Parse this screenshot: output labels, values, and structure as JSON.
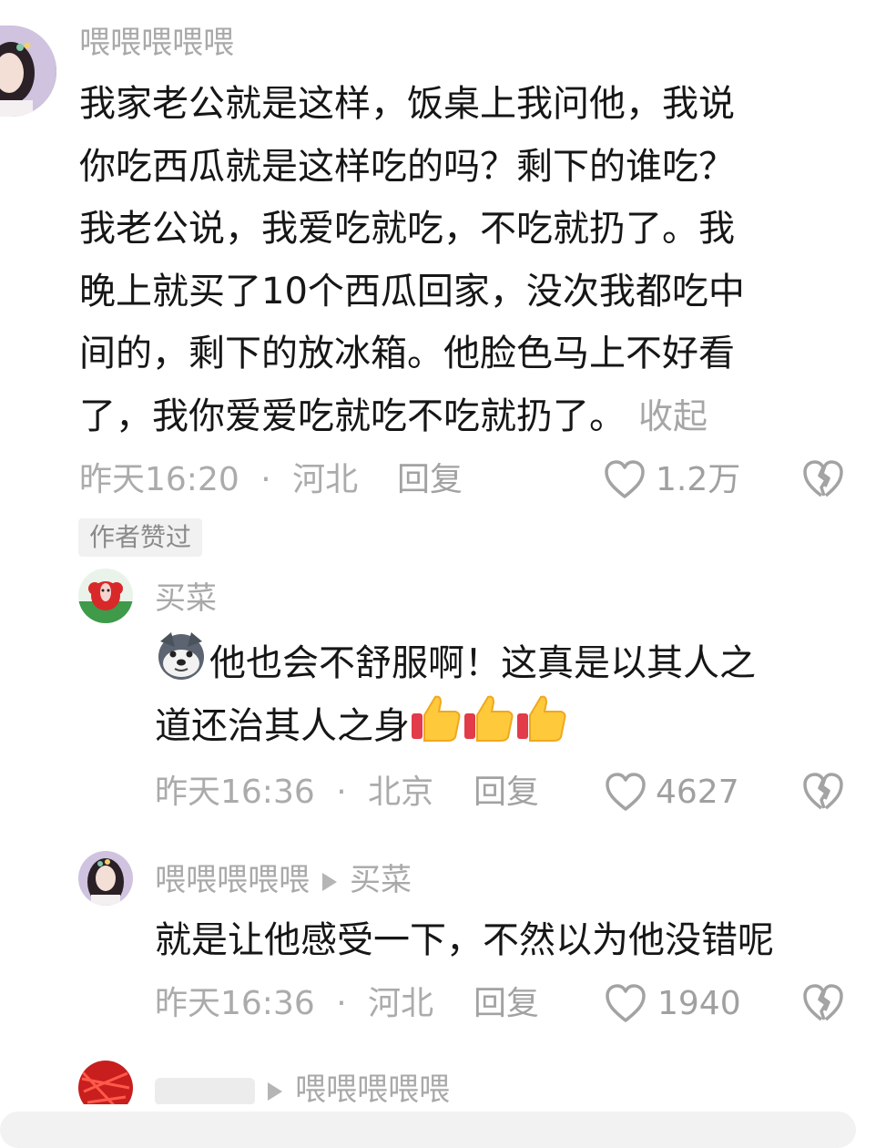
{
  "comments": [
    {
      "username": "喂喂喂喂喂",
      "text_lines": [
        "我家老公就是这样，饭桌上我问他，我说",
        "你吃西瓜就是这样吃的吗？剩下的谁吃？",
        "我老公说，我爱吃就吃，不吃就扔了。我",
        "晚上就买了10个西瓜回家，没次我都吃中",
        "间的，剩下的放冰箱。他脸色马上不好看",
        "了，我你爱爱吃就吃不吃就扔了。"
      ],
      "collapse_label": "收起",
      "time": "昨天16:20",
      "separator": "·",
      "location": "河北",
      "reply_label": "回复",
      "like_count": "1.2万",
      "author_badge": "作者赞过"
    },
    {
      "username": "买菜",
      "text_lines": [
        "他也会不舒服啊！这真是以其人之",
        "道还治其人之身"
      ],
      "time": "昨天16:36",
      "separator": "·",
      "location": "北京",
      "reply_label": "回复",
      "like_count": "4627"
    },
    {
      "username": "喂喂喂喂喂",
      "reply_to": "买菜",
      "text_lines": [
        "就是让他感受一下，不然以为他没错呢"
      ],
      "time": "昨天16:36",
      "separator": "·",
      "location": "河北",
      "reply_label": "回复",
      "like_count": "1940"
    },
    {
      "reply_to": "喂喂喂喂喂"
    }
  ],
  "colors": {
    "text": "#161616",
    "muted": "#a9a9a9",
    "badge_bg": "#f1f1f1"
  }
}
